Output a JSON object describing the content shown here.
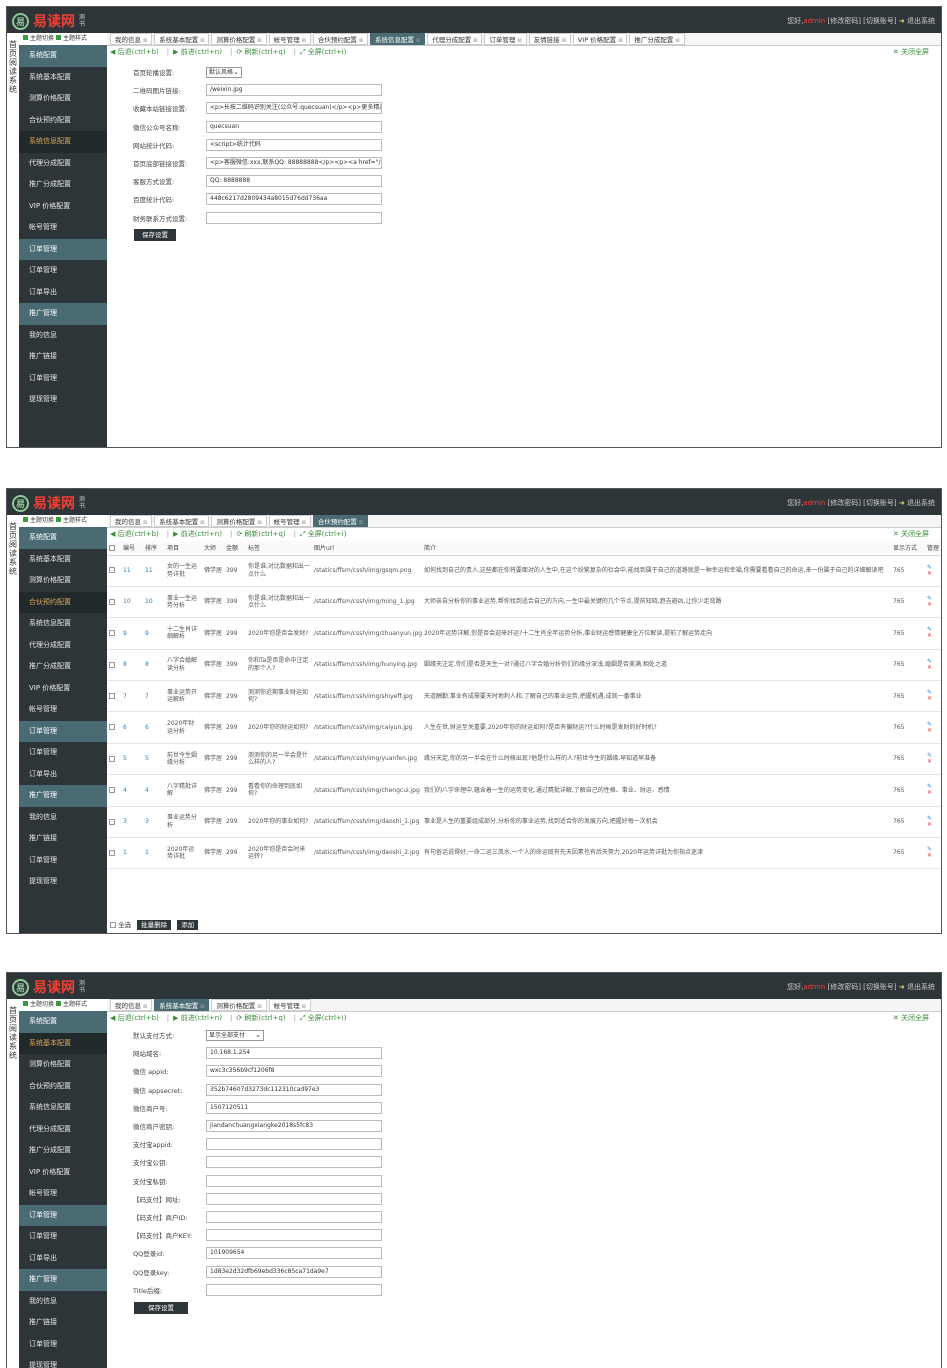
{
  "app": {
    "title": "易读网",
    "subtitle": "测书",
    "vnav": [
      "首",
      "页",
      "阅",
      "读",
      "系",
      "统"
    ],
    "greeting": "您好,",
    "user": "admin",
    "links": "[修改密码] [切换账号]",
    "logout": "退出系统",
    "sb_top": [
      "主题切换",
      "主题样式"
    ]
  },
  "sidebar": [
    {
      "label": "系统配置",
      "head": true
    },
    {
      "label": "系统基本配置"
    },
    {
      "label": "测算价格配置"
    },
    {
      "label": "合伙预约配置"
    },
    {
      "label": "系统信息配置"
    },
    {
      "label": "代理分成配置"
    },
    {
      "label": "推广分成配置"
    },
    {
      "label": "VIP 价格配置"
    },
    {
      "label": "帐号管理"
    },
    {
      "label": "订单管理",
      "head": true
    },
    {
      "label": "订单管理"
    },
    {
      "label": "订单导出"
    },
    {
      "label": "推广管理",
      "head": true
    },
    {
      "label": "我的信息"
    },
    {
      "label": "推广链接"
    },
    {
      "label": "订单管理"
    },
    {
      "label": "提现管理"
    }
  ],
  "toolbar": {
    "back": "后退(ctrl+b)",
    "forward": "前进(ctrl+n)",
    "refresh": "刷新(ctrl+q)",
    "fullscreen": "全屏(ctrl+i)",
    "close_full": "关闭全屏"
  },
  "panel1": {
    "tabs": [
      {
        "label": "我的信息"
      },
      {
        "label": "系统基本配置"
      },
      {
        "label": "测算价格配置"
      },
      {
        "label": "帐号管理"
      },
      {
        "label": "合伙预约配置"
      },
      {
        "label": "系统信息配置",
        "active": true
      },
      {
        "label": "代理分成配置"
      },
      {
        "label": "订单管理"
      },
      {
        "label": "友情链接"
      },
      {
        "label": "VIP 价格配置"
      },
      {
        "label": "推广分成配置"
      }
    ],
    "fields": [
      {
        "label": "首页轮播设置:",
        "select": "默认风格"
      },
      {
        "label": "二维码图片链接:",
        "value": "/weixin.jpg"
      },
      {
        "label": "收藏本站链接设置:",
        "value": "<p>长按二维码识别关注(公众号:quecsuan)</p><p>更多精品推荐"
      },
      {
        "label": "微信公众号名称:",
        "value": "quecsuan"
      },
      {
        "label": "网站统计代码:",
        "value": "<script>统计代码"
      },
      {
        "label": "首页底部链接设置:",
        "value": "<p>客服微信:xxx,联系QQ: 88888888</p><p><a href=\"/?oc-ab"
      },
      {
        "label": "客服方式设置:",
        "value": "QQ: 8888888"
      },
      {
        "label": "百度统计代码:",
        "value": "448c6217d2809434a8015d76dd736aa"
      },
      {
        "label": "财务联系方式设置:",
        "value": ""
      }
    ],
    "save": "保存设置"
  },
  "panel2": {
    "tabs": [
      {
        "label": "我的信息"
      },
      {
        "label": "系统基本配置"
      },
      {
        "label": "测算价格配置"
      },
      {
        "label": "帐号管理"
      },
      {
        "label": "合伙预约配置",
        "active": true
      }
    ],
    "columns": [
      "",
      "编号",
      "排序",
      "项目",
      "大师",
      "金额",
      "标签",
      "图片url",
      "简介",
      "显示方式",
      "管理"
    ],
    "rows": [
      {
        "id": "11",
        "sort": "11",
        "name": "女的一生运势详批",
        "master": "佛学居",
        "price": "399",
        "tag": "你是谁,对比数据和出一点什么",
        "img": "/statics/ffsm/cssh/img/gsqm.png",
        "desc": "如何找到自己的贵人,这些都在你将要面对的人生中,在这个纷繁复杂的社会中,能找到属于自己的道路就是一种幸运和幸福,你需要看看自己的命运,来一份属于自己的详细解读吧",
        "mode": "765"
      },
      {
        "id": "10",
        "sort": "10",
        "name": "事业一生运势分析",
        "master": "佛学居",
        "price": "399",
        "tag": "你是谁,对比数据和出一点什么",
        "img": "/statics/ffsm/cssh/img/ming_1.jpg",
        "desc": "大师亲自分析你的事业运势,帮你找到适合自己的方向,一生中最关键的几个节点,提前知晓,趋吉避凶,让你少走弯路",
        "mode": "765"
      },
      {
        "id": "9",
        "sort": "9",
        "name": "十二生肖详细解析",
        "master": "佛学居",
        "price": "299",
        "tag": "2020年你是否会发财?",
        "img": "/statics/ffsm/cssh/img/zhuanyun.jpg",
        "desc": "2020年运势详解,你是否会迎来好运?十二生肖全年运势分析,事业财运感情健康全方位解读,提前了解运势走向",
        "mode": "765"
      },
      {
        "id": "8",
        "sort": "8",
        "name": "八字合婚解读分析",
        "master": "佛学居",
        "price": "399",
        "tag": "你和Ta是否是命中注定的那个人?",
        "img": "/statics/ffsm/cssh/img/hunying.jpg",
        "desc": "姻缘天注定,你们是否是天生一对?通过八字合婚分析你们的缘分深浅,婚姻是否美满,相处之道",
        "mode": "765"
      },
      {
        "id": "7",
        "sort": "7",
        "name": "事业运势开运解析",
        "master": "佛学居",
        "price": "299",
        "tag": "测测你近期事业财运如何?",
        "img": "/statics/ffsm/cssh/img/shiyeff.jpg",
        "desc": "天道酬勤,事业有成需要天时地利人和,了解自己的事业运势,把握机遇,成就一番事业",
        "mode": "765"
      },
      {
        "id": "6",
        "sort": "6",
        "name": "2020年财运分析",
        "master": "佛学居",
        "price": "299",
        "tag": "2020年你的财运如何?",
        "img": "/statics/ffsm/cssh/img/caiyun.jpg",
        "desc": "人生在世,财运至关重要,2020年你的财运如何?是否有偏财运?什么时候是发财的好时机?",
        "mode": "765"
      },
      {
        "id": "5",
        "sort": "5",
        "name": "前世今生姻缘分析",
        "master": "佛学居",
        "price": "299",
        "tag": "测测你的另一半会是什么样的人?",
        "img": "/statics/ffsm/cssh/img/yuanfen.jpg",
        "desc": "缘分天定,你的另一半会在什么时候出现?他是什么样的人?前世今生的姻缘,早知道早准备",
        "mode": "765"
      },
      {
        "id": "4",
        "sort": "4",
        "name": "八字精批详解",
        "master": "佛学居",
        "price": "299",
        "tag": "看看你的命理到底如何?",
        "img": "/statics/ffsm/cssh/img/chengcui.jpg",
        "desc": "我们的八字命理中,蕴含着一生的运势变化,通过精批详解,了解自己的性格、事业、财运、感情",
        "mode": "765"
      },
      {
        "id": "3",
        "sort": "3",
        "name": "事业运势分析",
        "master": "佛学居",
        "price": "299",
        "tag": "2020年你的事业如何?",
        "img": "/statics/ffsm/cssh/img/daoshi_1.jpg",
        "desc": "事业是人生的重要组成部分,分析你的事业运势,找到适合你的发展方向,把握好每一次机会",
        "mode": "765"
      },
      {
        "id": "1",
        "sort": "1",
        "name": "2020年运势详批",
        "master": "佛学居",
        "price": "299",
        "tag": "2020年你是否会时来运转?",
        "img": "/statics/ffsm/cssh/img/daoshi_2.jpg",
        "desc": "有句俗话说得好,一命二运三风水,一个人的命运既有先天因素也有后天努力,2020年运势详批为你指点迷津",
        "mode": "765"
      }
    ],
    "footer": {
      "select_all": "全选",
      "delete_sel": "批量删除",
      "add": "添加"
    }
  },
  "panel3": {
    "tabs": [
      {
        "label": "我的信息"
      },
      {
        "label": "系统基本配置",
        "active": true
      },
      {
        "label": "测算价格配置"
      },
      {
        "label": "帐号管理"
      }
    ],
    "fields": [
      {
        "label": "默认支付方式:",
        "select": "显示全部支付"
      },
      {
        "label": "网站域名:",
        "value": "10.168.1.254"
      },
      {
        "label": "微信 appid:",
        "value": "wxc3c356b9cf1206f8"
      },
      {
        "label": "微信 appsecret:",
        "value": "352b74607d3273dc112310cad97e3"
      },
      {
        "label": "微信商户号:",
        "value": "1507120511"
      },
      {
        "label": "微信商户密钥:",
        "value": "jiandanchuangxiangke2018s5fc83"
      },
      {
        "label": "支付宝appid:",
        "value": ""
      },
      {
        "label": "支付宝公钥:",
        "value": ""
      },
      {
        "label": "支付宝私钥:",
        "value": ""
      },
      {
        "label": "【码支付】网址:",
        "value": ""
      },
      {
        "label": "【码支付】商户ID:",
        "value": ""
      },
      {
        "label": "【码支付】商户KEY:",
        "value": ""
      },
      {
        "label": "QQ登录id:",
        "value": "101909654"
      },
      {
        "label": "QQ登录key:",
        "value": "1d83e2d32dfb69ebd336c85ca71da9e7"
      },
      {
        "label": "Title后缀:",
        "value": ""
      }
    ],
    "save": "保存设置"
  }
}
